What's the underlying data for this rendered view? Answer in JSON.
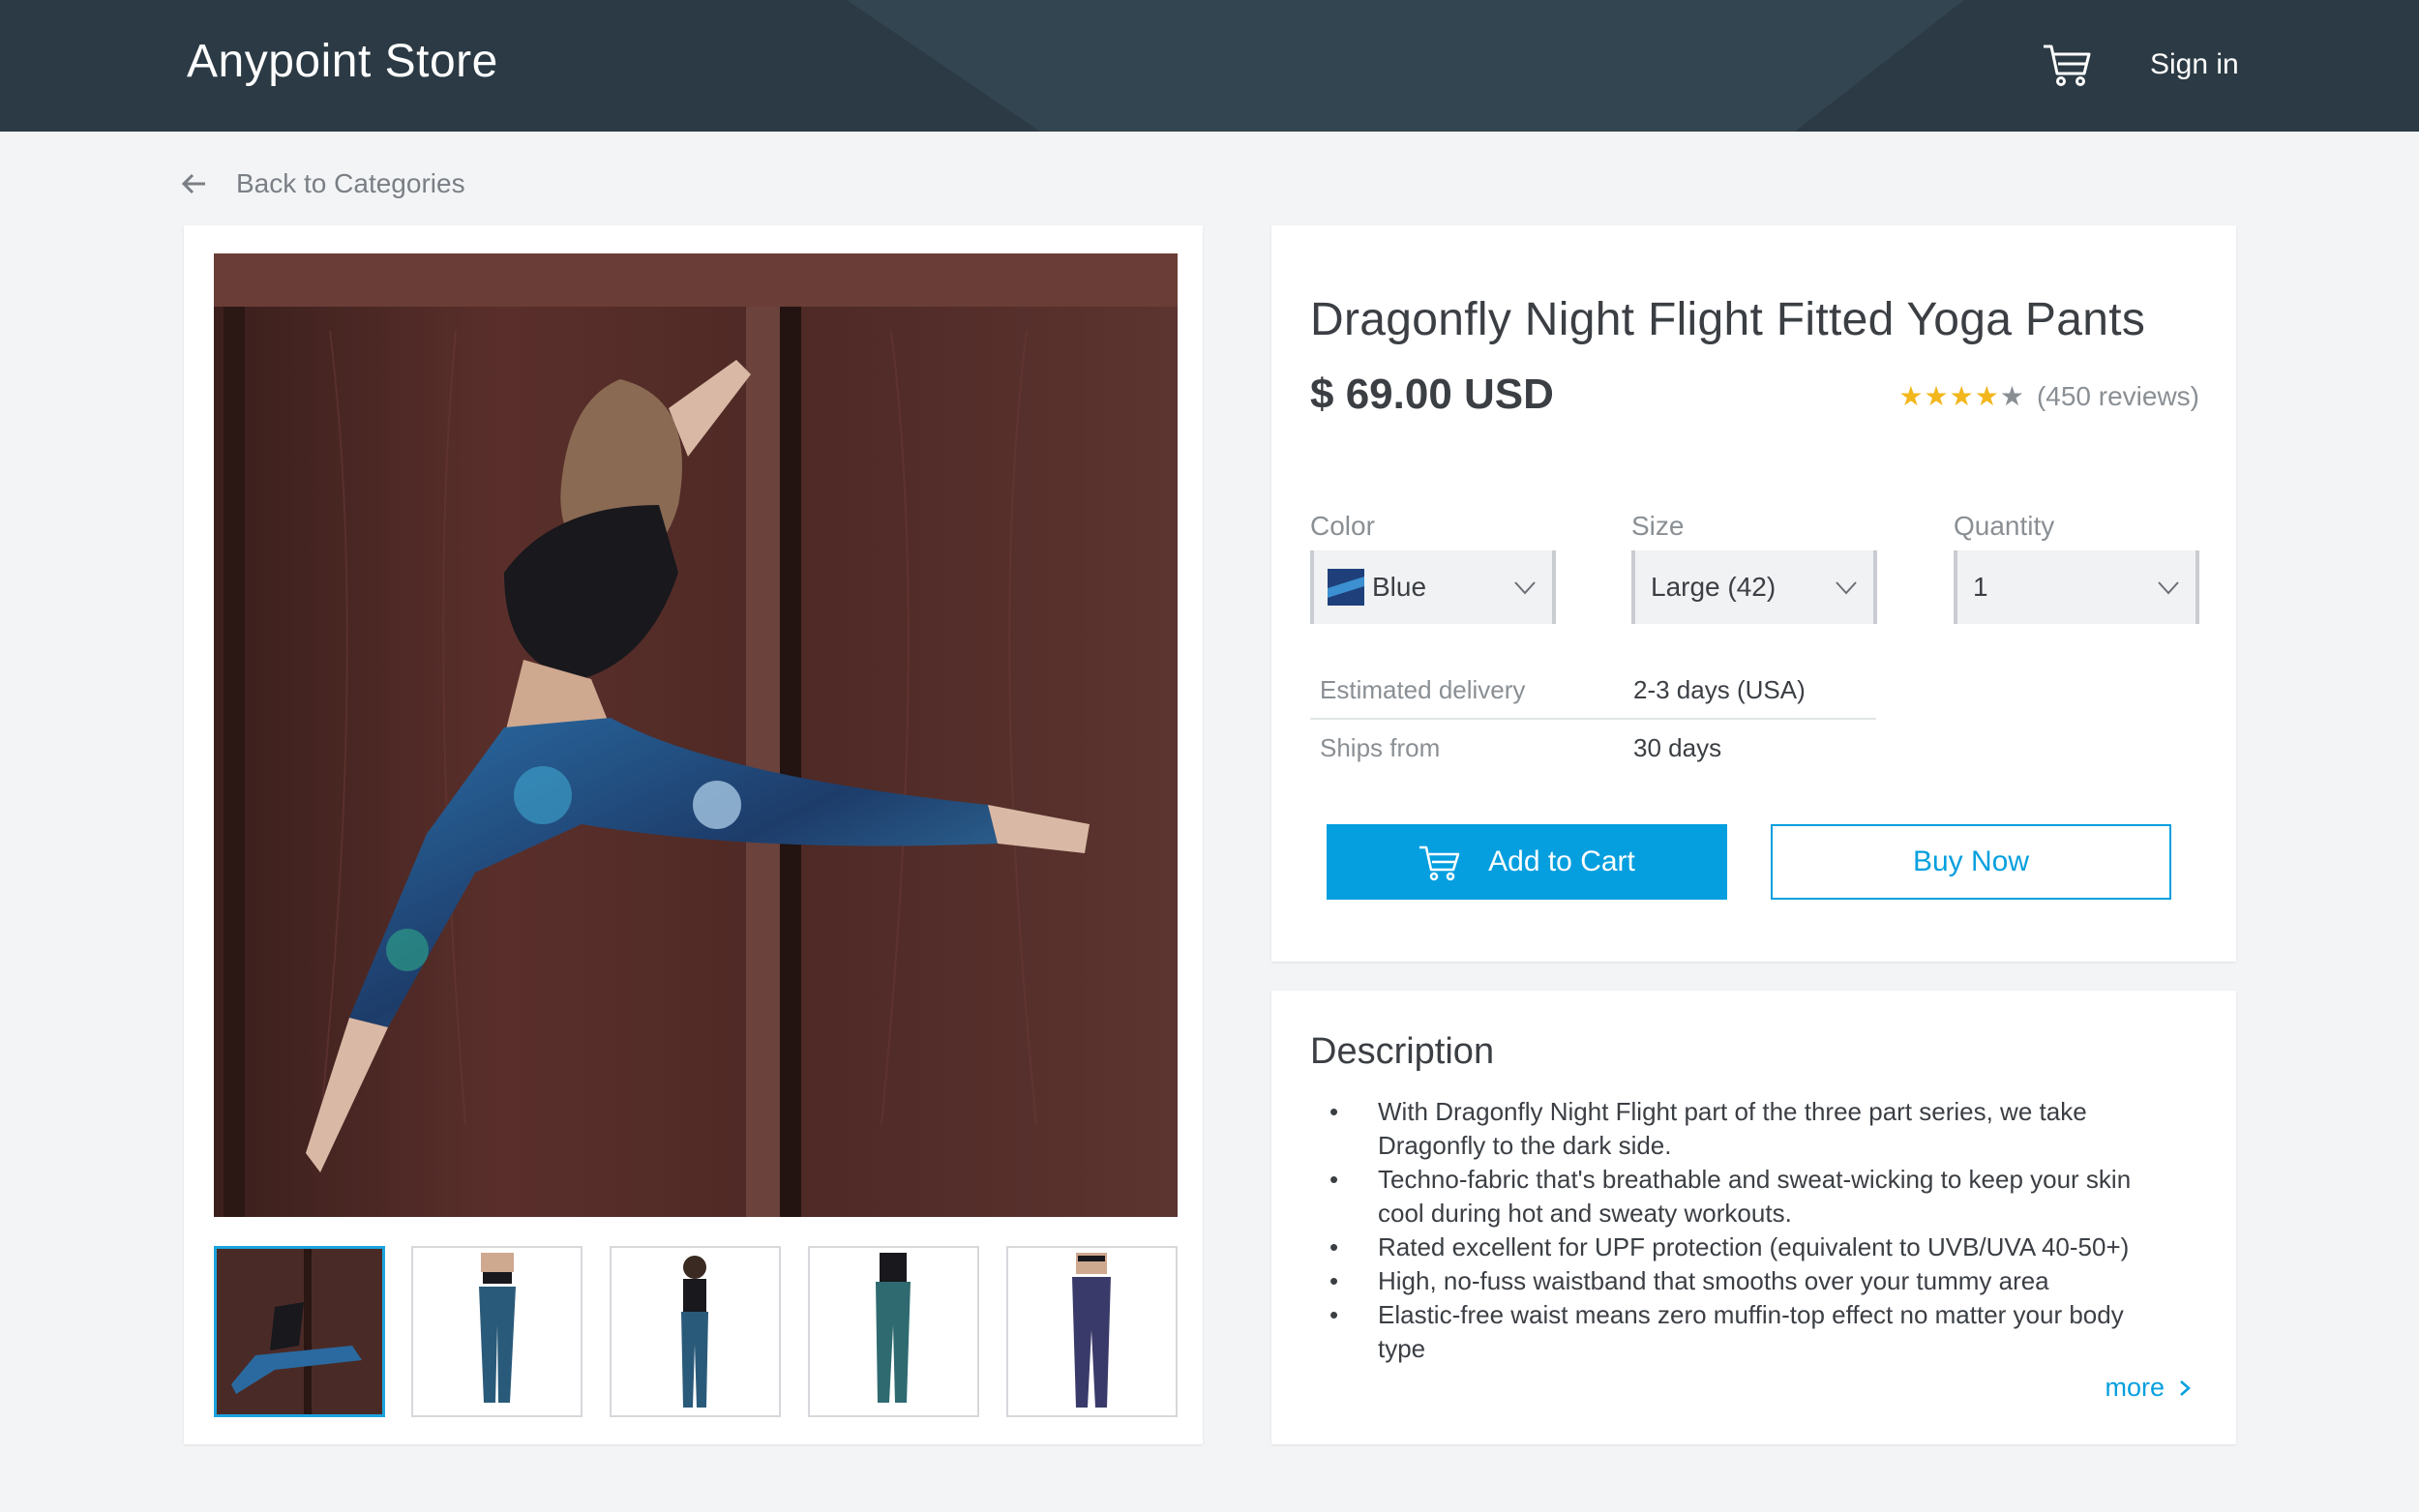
{
  "header": {
    "brand": "Anypoint Store",
    "sign_in": "Sign in",
    "cart_icon": "cart-icon"
  },
  "nav": {
    "back_label": "Back to Categories"
  },
  "gallery": {
    "thumbnail_count": 5,
    "active_index": 0
  },
  "product": {
    "title": "Dragonfly Night Flight Fitted Yoga Pants",
    "price": "$ 69.00 USD",
    "rating_stars": 4,
    "rating_max": 5,
    "reviews": "(450 reviews)",
    "color_label": "Color",
    "color_value": "Blue",
    "size_label": "Size",
    "size_value": "Large (42)",
    "quantity_label": "Quantity",
    "quantity_value": "1",
    "delivery_label": "Estimated delivery",
    "delivery_value": "2-3 days (USA)",
    "ships_label": "Ships from",
    "ships_value": "30 days",
    "add_to_cart": "Add to Cart",
    "buy_now": "Buy Now"
  },
  "description": {
    "title": "Description",
    "items": [
      "With Dragonfly Night Flight part of the three part series, we take Dragonfly to the dark side.",
      "Techno-fabric that's breathable and sweat-wicking to keep your skin cool during hot and sweaty workouts.",
      "Rated excellent for UPF protection (equivalent to UVB/UVA 40-50+)",
      "High, no-fuss waistband that smooths over your tummy area",
      "Elastic-free waist means zero muffin-top effect no matter your body type"
    ],
    "more": "more"
  },
  "colors": {
    "accent": "#059fdf",
    "header_bg": "#2b3a44",
    "star": "#f2b71d"
  }
}
